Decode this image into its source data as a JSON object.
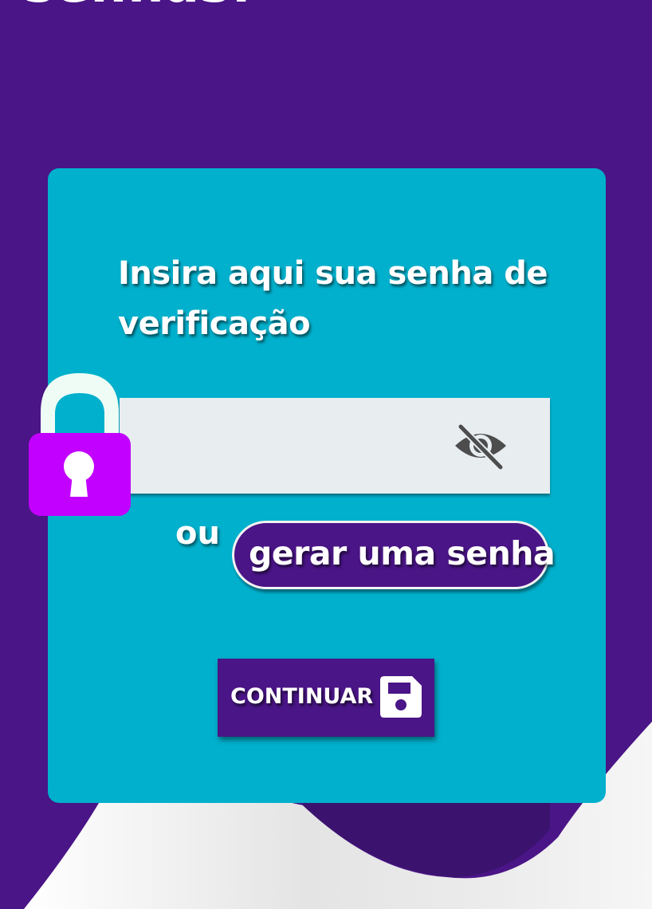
{
  "page": {
    "heading": "senhas:",
    "prompt": "Insira aqui sua senha de verificação"
  },
  "form": {
    "password_value": "",
    "password_placeholder": "",
    "or_label": "ou",
    "generate_label": "gerar uma senha",
    "continue_label": "CONTINUAR"
  },
  "icons": {
    "padlock": "padlock-icon",
    "visibility": "eye-off-icon",
    "save": "floppy-disk-icon"
  },
  "colors": {
    "background": "#4a1587",
    "card": "#00b0cc",
    "input": "#e8edf0",
    "padlock_body": "#c200ff",
    "padlock_shackle": "#eefcf5",
    "button": "#4a1587",
    "text": "#ffffff",
    "wave_light": "#efefef"
  }
}
